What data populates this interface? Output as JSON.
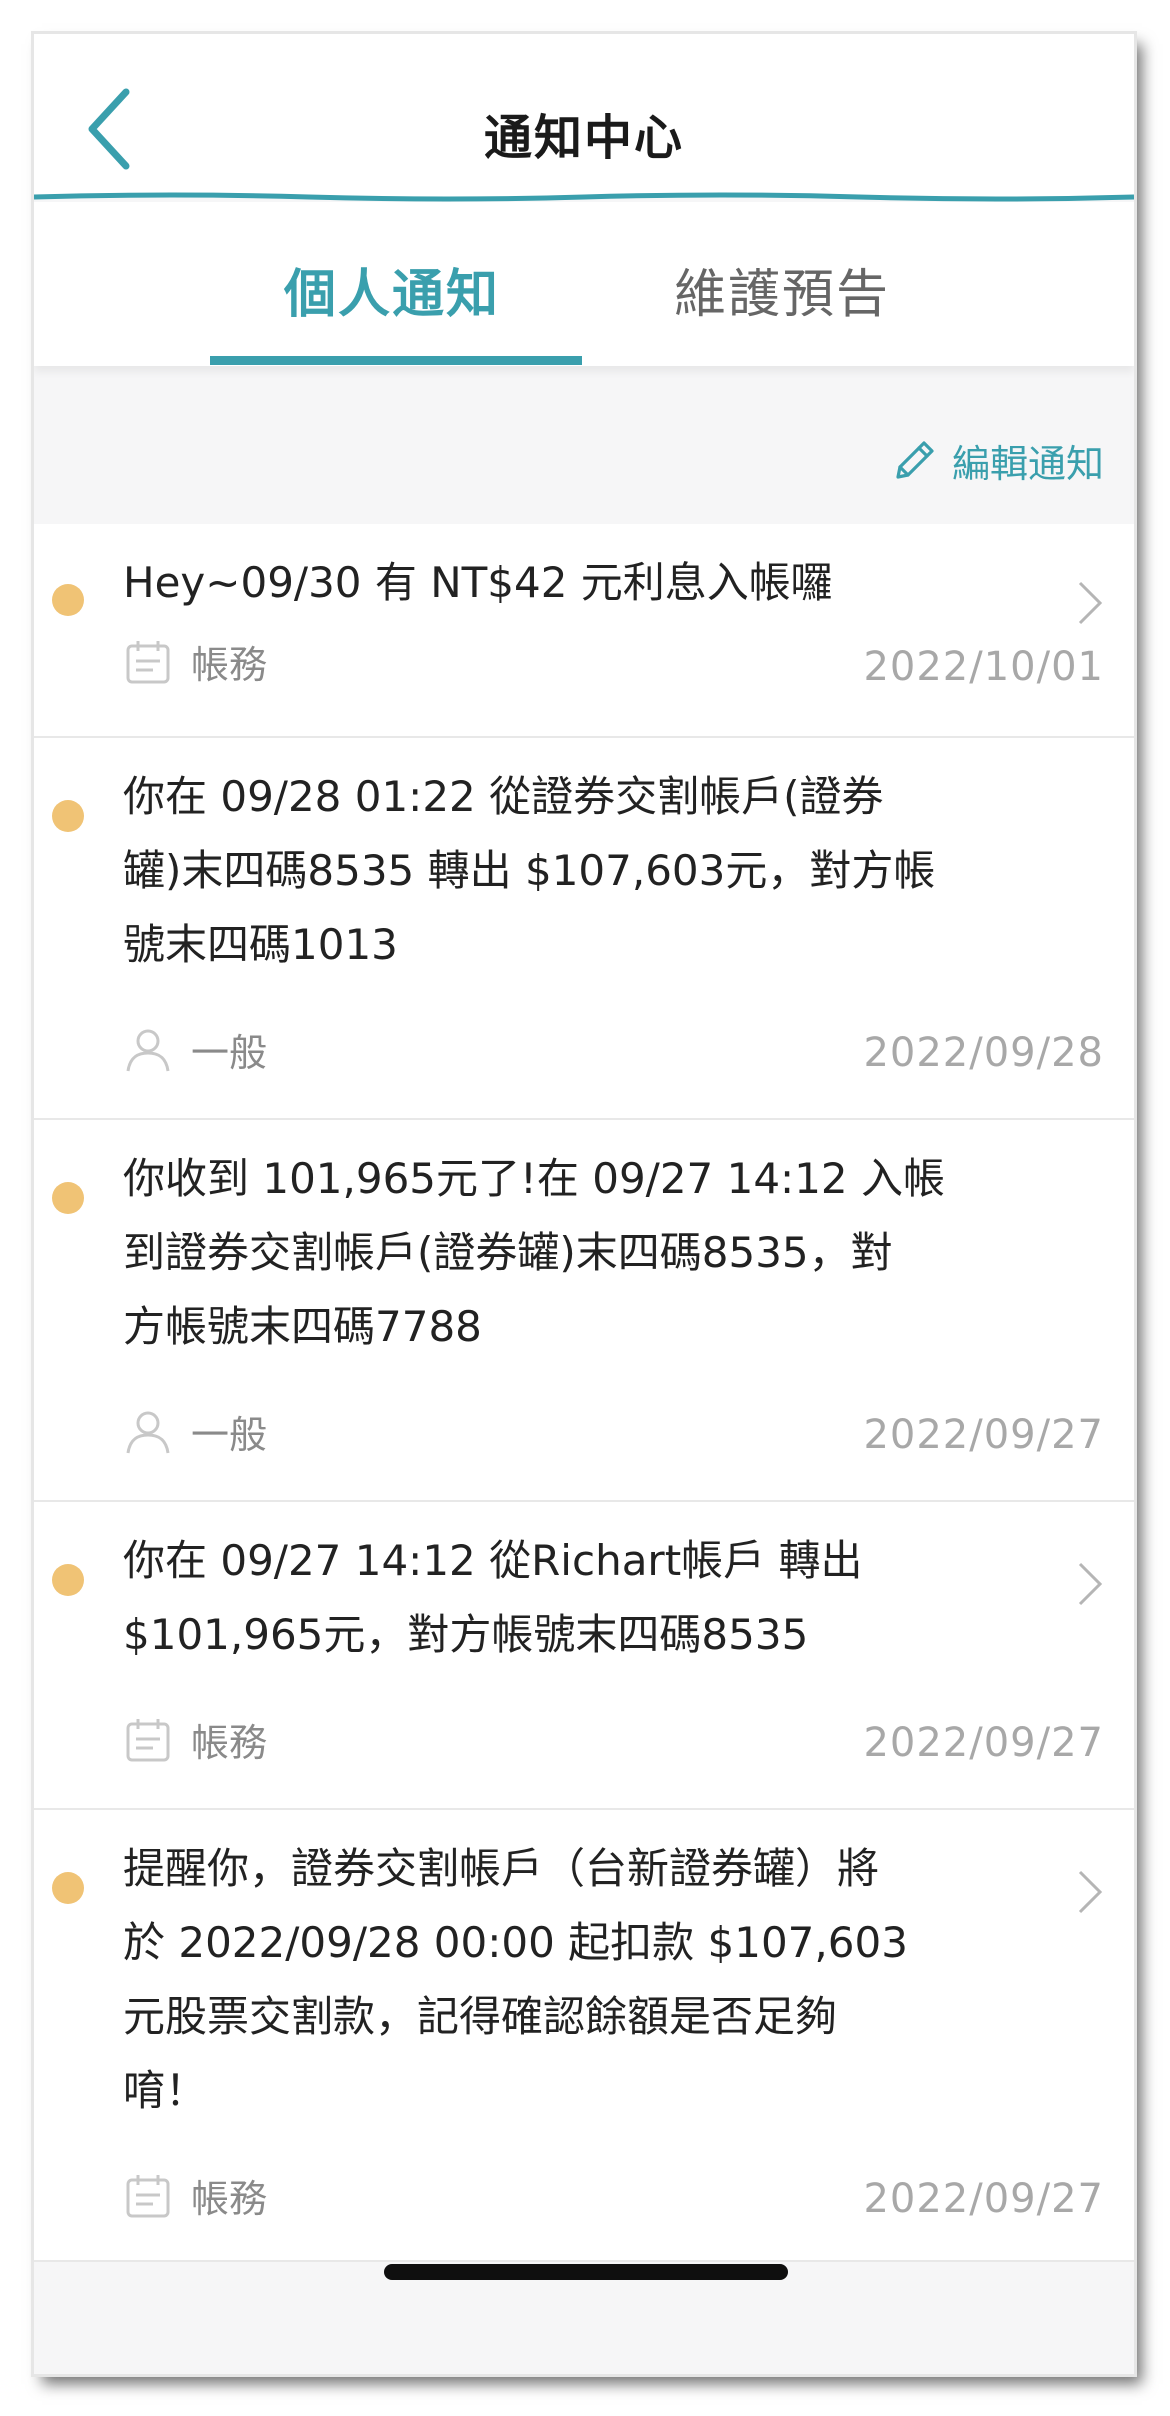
{
  "header": {
    "title": "通知中心",
    "back_icon": "chevron-left-icon"
  },
  "tabs": [
    {
      "label": "個人通知",
      "active": true
    },
    {
      "label": "維護預告",
      "active": false
    }
  ],
  "edit": {
    "label": "編輯通知",
    "icon": "pencil-icon"
  },
  "colors": {
    "accent": "#3a9fad",
    "unread_dot": "#f0c375"
  },
  "notifications": [
    {
      "message": "Hey~09/30 有 NT$42 元利息入帳囉",
      "category": "帳務",
      "category_icon": "calendar-icon",
      "date": "2022/10/01",
      "has_chevron": true
    },
    {
      "message": "你在 09/28 01:22 從證券交割帳戶(證券\n罐)末四碼8535 轉出 $107,603元，對方帳\n號末四碼1013",
      "category": "一般",
      "category_icon": "person-icon",
      "date": "2022/09/28",
      "has_chevron": false
    },
    {
      "message": "你收到 101,965元了!在 09/27 14:12 入帳\n到證券交割帳戶(證券罐)末四碼8535，對\n方帳號末四碼7788",
      "category": "一般",
      "category_icon": "person-icon",
      "date": "2022/09/27",
      "has_chevron": false
    },
    {
      "message": "你在 09/27 14:12 從Richart帳戶 轉出\n$101,965元，對方帳號末四碼8535",
      "category": "帳務",
      "category_icon": "calendar-icon",
      "date": "2022/09/27",
      "has_chevron": true
    },
    {
      "message": "提醒你，證券交割帳戶（台新證券罐）將\n於 2022/09/28 00:00 起扣款 $107,603\n元股票交割款，記得確認餘額是否足夠\n唷！",
      "category": "帳務",
      "category_icon": "calendar-icon",
      "date": "2022/09/27",
      "has_chevron": true
    }
  ]
}
